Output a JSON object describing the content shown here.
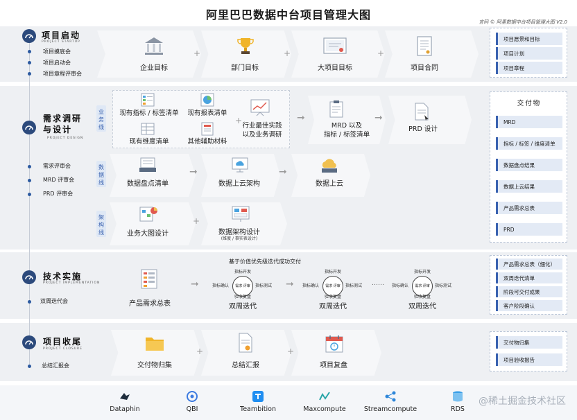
{
  "title": "阿里巴巴数据中台项目管理大图",
  "credit": "言码 © 阿里数据中台项目管理大图 V2.0",
  "stages": {
    "startup": {
      "name": "项目启动",
      "en": "PROJECT STARTUP",
      "meetings": [
        "项目摸底会",
        "项目启动会",
        "项目章程评审会"
      ],
      "steps": [
        "企业目标",
        "部门目标",
        "大项目目标",
        "项目合同"
      ],
      "deliverables": [
        "项目愿景和目标",
        "项目计划",
        "项目章程"
      ]
    },
    "design": {
      "name_line1": "需求调研",
      "name_line2": "与设计",
      "en": "PROJECT DESIGN",
      "meetings": [
        "需求评审会",
        "MRD 评审会",
        "PRD 评审会"
      ],
      "business_track": "业务线",
      "data_track": "数据线",
      "arch_track": "架构线",
      "business_items": [
        "现有指标 / 标签清单",
        "现有报表清单",
        "现有维度清单",
        "其他辅助材料"
      ],
      "best_practice": [
        "行业最佳实践",
        "以及业务调研"
      ],
      "mrd": [
        "MRD 以及",
        "指标 / 标签清单"
      ],
      "prd": "PRD 设计",
      "data_steps": [
        "数据盘点清单",
        "数据上云架构",
        "数据上云"
      ],
      "arch_steps": [
        "业务大图设计",
        "数据架构设计"
      ],
      "arch_sub": "(维度 / 事实表设计)",
      "deliverables_title": "交付物",
      "deliverables": [
        "MRD",
        "指标 / 标签 / 维度清单",
        "数据盘点结果",
        "数据上云结果",
        "产品需求总表",
        "PRD"
      ]
    },
    "implement": {
      "name": "技术实施",
      "en": "PROJECT IMPLEMENTATION",
      "meetings": [
        "双周迭代会"
      ],
      "headline": "基于价值优先级迭代成功交付",
      "start_label": "产品需求总表",
      "iteration_label": "双周迭代",
      "iter_top": "指标开发",
      "iter_left": "指标确认",
      "iter_right": "指标测试",
      "iter_bottom": "验收复盘",
      "iter_center": "需求 评审",
      "ellipsis": "……",
      "deliverables": [
        "产品需求总表（细化）",
        "双周迭代清单",
        "阶段可交付成果",
        "客户阶段确认"
      ]
    },
    "closure": {
      "name": "项目收尾",
      "en": "PROJECT CLOSURE",
      "meetings": [
        "总结汇报会"
      ],
      "steps": [
        "交付物归集",
        "总结汇报",
        "项目复盘"
      ],
      "deliverables": [
        "交付物归集",
        "项目验收报告"
      ]
    }
  },
  "tools": [
    {
      "name": "Dataphin",
      "icon": "dataphin-icon",
      "color": "#1f2d3d"
    },
    {
      "name": "QBI",
      "icon": "qbi-icon",
      "color": "#3d7be0"
    },
    {
      "name": "Teambition",
      "icon": "teambition-icon",
      "color": "#1f8ef1"
    },
    {
      "name": "Maxcompute",
      "icon": "maxcompute-icon",
      "color": "#2aa6a8"
    },
    {
      "name": "Streamcompute",
      "icon": "streamcompute-icon",
      "color": "#2d86d9"
    },
    {
      "name": "RDS",
      "icon": "rds-icon",
      "color": "#3aa0e8"
    }
  ],
  "watermark": "@稀土掘金技术社区",
  "colors": {
    "accent": "#2c4a7c",
    "band": "#eef0f3",
    "deliverable": "#3a62b0"
  }
}
